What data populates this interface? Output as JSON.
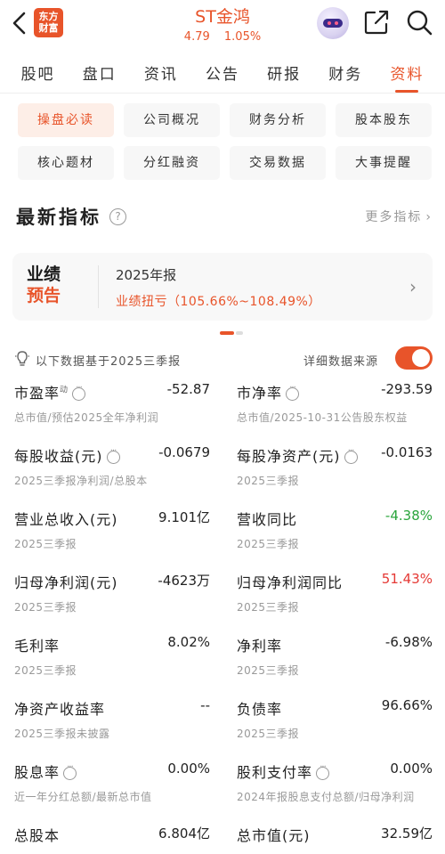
{
  "header": {
    "stock_name": "ST金鸿",
    "price": "4.79",
    "change_pct": "1.05%",
    "logo_line1": "东方",
    "logo_line2": "财富",
    "accent_color": "#e8542a"
  },
  "tabs": [
    {
      "label": "股吧",
      "active": false
    },
    {
      "label": "盘口",
      "active": false
    },
    {
      "label": "资讯",
      "active": false
    },
    {
      "label": "公告",
      "active": false
    },
    {
      "label": "研报",
      "active": false
    },
    {
      "label": "财务",
      "active": false
    },
    {
      "label": "资料",
      "active": true
    }
  ],
  "subtabs": [
    {
      "label": "操盘必读",
      "active": true
    },
    {
      "label": "公司概况",
      "active": false
    },
    {
      "label": "财务分析",
      "active": false
    },
    {
      "label": "股本股东",
      "active": false
    },
    {
      "label": "核心题材",
      "active": false
    },
    {
      "label": "分红融资",
      "active": false
    },
    {
      "label": "交易数据",
      "active": false
    },
    {
      "label": "大事提醒",
      "active": false
    }
  ],
  "section": {
    "title": "最新指标",
    "help_glyph": "?",
    "more_label": "更多指标"
  },
  "forecast": {
    "badge_line1": "业绩",
    "badge_line2": "预告",
    "title": "2025年报",
    "desc": "业绩扭亏（105.66%~108.49%）"
  },
  "basis": {
    "text": "以下数据基于2025三季报",
    "source_label": "详细数据来源",
    "toggle_on": true
  },
  "metrics": [
    {
      "left": {
        "label": "市盈率",
        "sup": "动",
        "info": true,
        "value": "-52.87",
        "tone": "",
        "sub": "总市值/预估2025全年净利润"
      },
      "right": {
        "label": "市净率",
        "sup": "",
        "info": true,
        "value": "-293.59",
        "tone": "",
        "sub": "总市值/2025-10-31公告股东权益"
      }
    },
    {
      "left": {
        "label": "每股收益(元)",
        "sup": "",
        "info": true,
        "value": "-0.0679",
        "tone": "",
        "sub": "2025三季报净利润/总股本"
      },
      "right": {
        "label": "每股净资产(元)",
        "sup": "",
        "info": true,
        "value": "-0.0163",
        "tone": "",
        "sub": "2025三季报"
      }
    },
    {
      "left": {
        "label": "营业总收入(元)",
        "sup": "",
        "info": false,
        "value": "9.101亿",
        "tone": "",
        "sub": "2025三季报"
      },
      "right": {
        "label": "营收同比",
        "sup": "",
        "info": false,
        "value": "-4.38%",
        "tone": "down",
        "sub": "2025三季报"
      }
    },
    {
      "left": {
        "label": "归母净利润(元)",
        "sup": "",
        "info": false,
        "value": "-4623万",
        "tone": "",
        "sub": "2025三季报"
      },
      "right": {
        "label": "归母净利润同比",
        "sup": "",
        "info": false,
        "value": "51.43%",
        "tone": "up",
        "sub": "2025三季报"
      }
    },
    {
      "left": {
        "label": "毛利率",
        "sup": "",
        "info": false,
        "value": "8.02%",
        "tone": "",
        "sub": "2025三季报"
      },
      "right": {
        "label": "净利率",
        "sup": "",
        "info": false,
        "value": "-6.98%",
        "tone": "",
        "sub": "2025三季报"
      }
    },
    {
      "left": {
        "label": "净资产收益率",
        "sup": "",
        "info": false,
        "value": "--",
        "tone": "",
        "sub": "2025三季报未披露"
      },
      "right": {
        "label": "负债率",
        "sup": "",
        "info": false,
        "value": "96.66%",
        "tone": "",
        "sub": "2025三季报"
      }
    },
    {
      "left": {
        "label": "股息率",
        "sup": "",
        "info": true,
        "value": "0.00%",
        "tone": "",
        "sub": "近一年分红总额/最新总市值"
      },
      "right": {
        "label": "股利支付率",
        "sup": "",
        "info": true,
        "value": "0.00%",
        "tone": "",
        "sub": "2024年报股息支付总额/归母净利润"
      }
    },
    {
      "left": {
        "label": "总股本",
        "sup": "",
        "info": false,
        "value": "6.804亿",
        "tone": "",
        "sub": ""
      },
      "right": {
        "label": "总市值(元)",
        "sup": "",
        "info": false,
        "value": "32.59亿",
        "tone": "",
        "sub": ""
      }
    }
  ]
}
